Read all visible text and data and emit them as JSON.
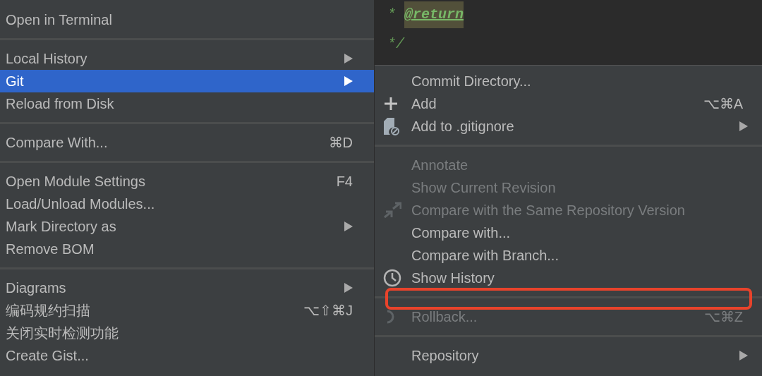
{
  "context_menu": {
    "items": [
      {
        "kind": "item",
        "label": "Open in Terminal",
        "selected": false,
        "disabled": false
      },
      {
        "kind": "separator"
      },
      {
        "kind": "item",
        "label": "Local History",
        "submenu": true,
        "selected": false,
        "disabled": false
      },
      {
        "kind": "item",
        "label": "Git",
        "submenu": true,
        "selected": true,
        "disabled": false
      },
      {
        "kind": "item",
        "label": "Reload from Disk",
        "selected": false,
        "disabled": false
      },
      {
        "kind": "separator"
      },
      {
        "kind": "item",
        "label": "Compare With...",
        "shortcut": "⌘D",
        "selected": false,
        "disabled": false
      },
      {
        "kind": "separator"
      },
      {
        "kind": "item",
        "label": "Open Module Settings",
        "shortcut": "F4",
        "selected": false,
        "disabled": false
      },
      {
        "kind": "item",
        "label": "Load/Unload Modules...",
        "selected": false,
        "disabled": false
      },
      {
        "kind": "item",
        "label": "Mark Directory as",
        "submenu": true,
        "selected": false,
        "disabled": false
      },
      {
        "kind": "item",
        "label": "Remove BOM",
        "selected": false,
        "disabled": false
      },
      {
        "kind": "separator"
      },
      {
        "kind": "item",
        "label": "Diagrams",
        "submenu": true,
        "selected": false,
        "disabled": false
      },
      {
        "kind": "item",
        "label": "编码规约扫描",
        "shortcut": "⌥⇧⌘J",
        "selected": false,
        "disabled": false
      },
      {
        "kind": "item",
        "label": "关闭实时检测功能",
        "selected": false,
        "disabled": false
      },
      {
        "kind": "item",
        "label": "Create Gist...",
        "selected": false,
        "disabled": false
      }
    ]
  },
  "editor": {
    "lines": [
      {
        "text": "*",
        "tag": "@return"
      },
      {
        "text": "*/"
      }
    ]
  },
  "git_submenu": {
    "items": [
      {
        "kind": "item",
        "label": "Commit Directory...",
        "selected": false,
        "disabled": false
      },
      {
        "kind": "add",
        "label": "Add",
        "shortcut": "⌥⌘A",
        "selected": false,
        "disabled": false
      },
      {
        "kind": "ignore",
        "label": "Add to .gitignore",
        "submenu": true,
        "selected": false,
        "disabled": false
      },
      {
        "kind": "separator"
      },
      {
        "kind": "item",
        "label": "Annotate",
        "selected": false,
        "disabled": true
      },
      {
        "kind": "item",
        "label": "Show Current Revision",
        "selected": false,
        "disabled": true
      },
      {
        "kind": "compare",
        "label": "Compare with the Same Repository Version",
        "selected": false,
        "disabled": true
      },
      {
        "kind": "item",
        "label": "Compare with...",
        "selected": false,
        "disabled": false
      },
      {
        "kind": "item",
        "label": "Compare with Branch...",
        "selected": false,
        "disabled": false
      },
      {
        "kind": "history",
        "label": "Show History",
        "selected": false,
        "disabled": false
      },
      {
        "kind": "separator"
      },
      {
        "kind": "rollback",
        "label": "Rollback...",
        "shortcut": "⌥⌘Z",
        "selected": false,
        "disabled": true
      },
      {
        "kind": "separator"
      },
      {
        "kind": "item",
        "label": "Repository",
        "submenu": true,
        "selected": false,
        "disabled": false
      }
    ]
  },
  "annotations": [
    {
      "kind": "rectangle"
    }
  ]
}
